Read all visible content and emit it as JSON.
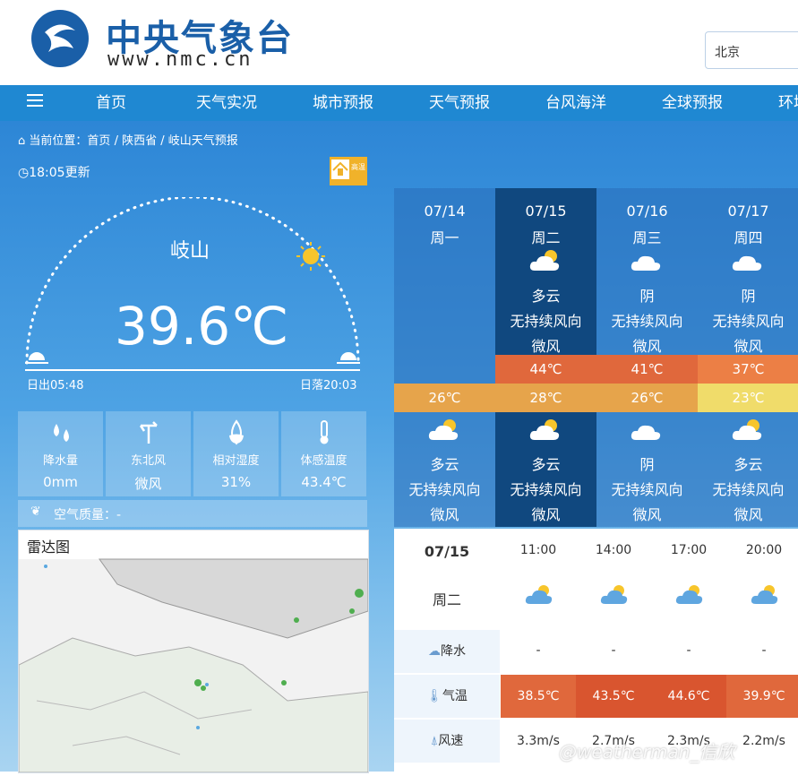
{
  "header": {
    "logo_title": "中央气象台",
    "logo_url": "www.nmc.cn",
    "search_value": "北京"
  },
  "nav": {
    "items": [
      "首页",
      "天气实况",
      "城市预报",
      "天气预报",
      "台风海洋",
      "全球预报",
      "环境"
    ]
  },
  "breadcrumb": {
    "prefix": "当前位置：",
    "items": [
      "首页",
      "陕西省",
      "岐山天气预报"
    ]
  },
  "current": {
    "update_time": "18:05更新",
    "city": "岐山",
    "temperature": "39.6℃",
    "sunrise": "日出05:48",
    "sunset": "日落20:03",
    "alert_text": "高温",
    "stats": [
      {
        "label": "降水量",
        "value": "0mm",
        "icon": "raindrops-icon"
      },
      {
        "label": "东北风",
        "value": "微风",
        "icon": "wind-vane-icon"
      },
      {
        "label": "相对湿度",
        "value": "31%",
        "icon": "humidity-drop-icon"
      },
      {
        "label": "体感温度",
        "value": "43.4℃",
        "icon": "thermometer-icon"
      }
    ],
    "aqi_label": "空气质量：-",
    "radar_title": "雷达图"
  },
  "forecast": [
    {
      "date": "07/14",
      "weekday": "周一",
      "day_weather": "",
      "day_wind": "",
      "day_level": "",
      "high": "",
      "low": "26℃",
      "night_weather": "多云",
      "night_wind": "无持续风向",
      "night_level": "微风"
    },
    {
      "date": "07/15",
      "weekday": "周二",
      "day_weather": "多云",
      "day_wind": "无持续风向",
      "day_level": "微风",
      "high": "44℃",
      "low": "28℃",
      "night_weather": "多云",
      "night_wind": "无持续风向",
      "night_level": "微风"
    },
    {
      "date": "07/16",
      "weekday": "周三",
      "day_weather": "阴",
      "day_wind": "无持续风向",
      "day_level": "微风",
      "high": "41℃",
      "low": "26℃",
      "night_weather": "阴",
      "night_wind": "无持续风向",
      "night_level": "微风"
    },
    {
      "date": "07/17",
      "weekday": "周四",
      "day_weather": "阴",
      "day_wind": "无持续风向",
      "day_level": "微风",
      "high": "37℃",
      "low": "23℃",
      "night_weather": "多云",
      "night_wind": "无持续风向",
      "night_level": "微风"
    }
  ],
  "hourly": {
    "date": "07/15",
    "weekday": "周二",
    "times": [
      "11:00",
      "14:00",
      "17:00",
      "20:00"
    ],
    "rows": {
      "precip_label": "降水",
      "precip": [
        "-",
        "-",
        "-",
        "-"
      ],
      "temp_label": "气温",
      "temp": [
        "38.5℃",
        "43.5℃",
        "44.6℃",
        "39.9℃"
      ],
      "wind_label": "风速",
      "wind": [
        "3.3m/s",
        "2.7m/s",
        "2.3m/s",
        "2.2m/s"
      ]
    }
  },
  "watermark": "@weatherman_信欣",
  "colors": {
    "nav": "#1f88d2",
    "active_column": "#10487f",
    "hot": "#e0683c",
    "warm": "#e6a44b",
    "mild": "#f0dc6a"
  }
}
